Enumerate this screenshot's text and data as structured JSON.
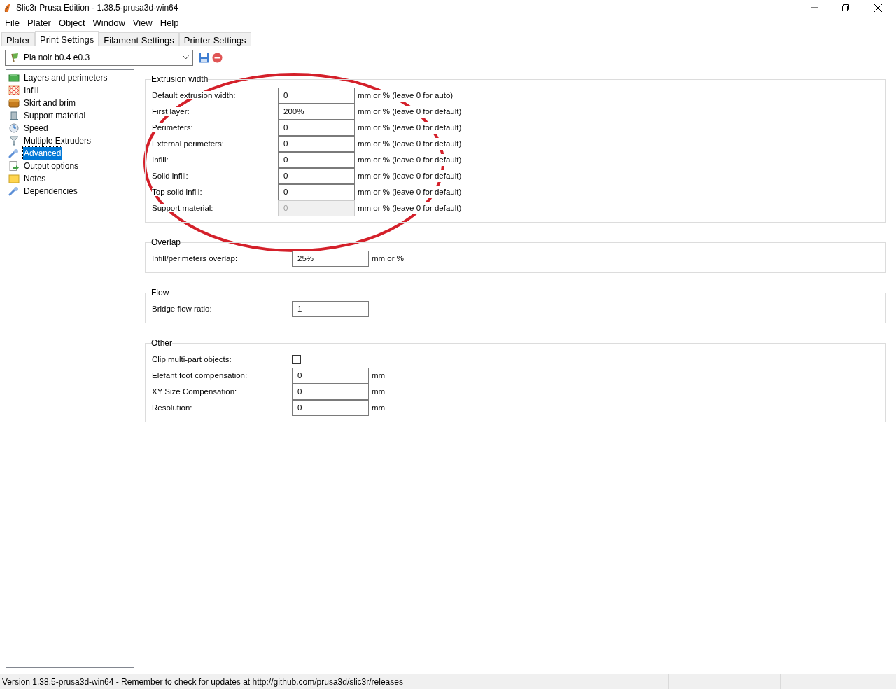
{
  "window": {
    "title": "Slic3r Prusa Edition - 1.38.5-prusa3d-win64"
  },
  "menu": [
    "File",
    "Plater",
    "Object",
    "Window",
    "View",
    "Help"
  ],
  "tabs": [
    {
      "label": "Plater",
      "selected": false
    },
    {
      "label": "Print Settings",
      "selected": true
    },
    {
      "label": "Filament Settings",
      "selected": false
    },
    {
      "label": "Printer Settings",
      "selected": false
    }
  ],
  "preset": {
    "value": "Pla noir b0.4 e0.3"
  },
  "sidebar": {
    "items": [
      {
        "label": "Layers and perimeters",
        "selected": false
      },
      {
        "label": "Infill",
        "selected": false
      },
      {
        "label": "Skirt and brim",
        "selected": false
      },
      {
        "label": "Support material",
        "selected": false
      },
      {
        "label": "Speed",
        "selected": false
      },
      {
        "label": "Multiple Extruders",
        "selected": false
      },
      {
        "label": "Advanced",
        "selected": true
      },
      {
        "label": "Output options",
        "selected": false
      },
      {
        "label": "Notes",
        "selected": false
      },
      {
        "label": "Dependencies",
        "selected": false
      }
    ]
  },
  "groups": [
    {
      "title": "Extrusion width",
      "rows": [
        {
          "kind": "text",
          "label": "Default extrusion width:",
          "value": "0",
          "unit": "mm or % (leave 0 for auto)",
          "disabled": false
        },
        {
          "kind": "text",
          "label": "First layer:",
          "value": "200%",
          "unit": "mm or % (leave 0 for default)",
          "disabled": false
        },
        {
          "kind": "text",
          "label": "Perimeters:",
          "value": "0",
          "unit": "mm or % (leave 0 for default)",
          "disabled": false
        },
        {
          "kind": "text",
          "label": "External perimeters:",
          "value": "0",
          "unit": "mm or % (leave 0 for default)",
          "disabled": false
        },
        {
          "kind": "text",
          "label": "Infill:",
          "value": "0",
          "unit": "mm or % (leave 0 for default)",
          "disabled": false
        },
        {
          "kind": "text",
          "label": "Solid infill:",
          "value": "0",
          "unit": "mm or % (leave 0 for default)",
          "disabled": false
        },
        {
          "kind": "text",
          "label": "Top solid infill:",
          "value": "0",
          "unit": "mm or % (leave 0 for default)",
          "disabled": false
        },
        {
          "kind": "text",
          "label": "Support material:",
          "value": "0",
          "unit": "mm or % (leave 0 for default)",
          "disabled": true
        }
      ]
    },
    {
      "title": "Overlap",
      "rows": [
        {
          "kind": "text",
          "label": "Infill/perimeters overlap:",
          "value": "25%",
          "unit": "mm or %",
          "disabled": false
        }
      ]
    },
    {
      "title": "Flow",
      "rows": [
        {
          "kind": "text",
          "label": "Bridge flow ratio:",
          "value": "1",
          "disabled": false
        }
      ]
    },
    {
      "title": "Other",
      "rows": [
        {
          "kind": "checkbox",
          "label": "Clip multi-part objects:",
          "checked": false
        },
        {
          "kind": "text",
          "label": "Elefant foot compensation:",
          "value": "0",
          "unit": "mm",
          "disabled": false
        },
        {
          "kind": "text",
          "label": "XY Size Compensation:",
          "value": "0",
          "unit": "mm",
          "disabled": false
        },
        {
          "kind": "text",
          "label": "Resolution:",
          "value": "0",
          "unit": "mm",
          "disabled": false
        }
      ]
    }
  ],
  "status_bar": {
    "text": "Version 1.38.5-prusa3d-win64 - Remember to check for updates at http://github.com/prusa3d/slic3r/releases"
  }
}
